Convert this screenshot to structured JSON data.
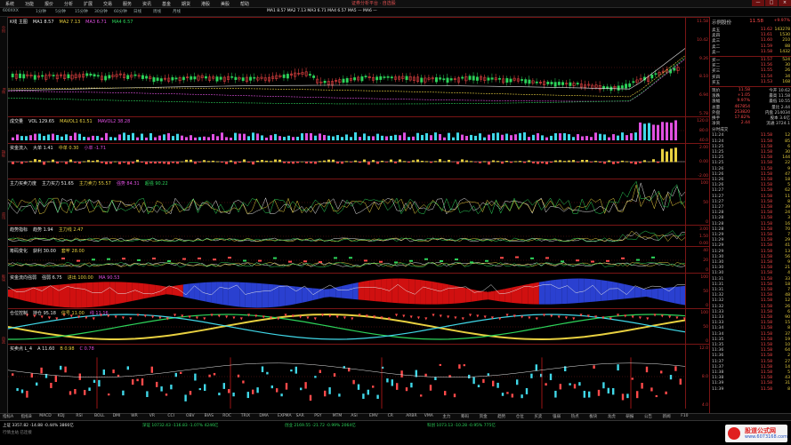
{
  "window": {
    "title": "证券分析平台 · 自选股",
    "controls": [
      "—",
      "□",
      "×"
    ]
  },
  "menu": [
    "系统",
    "功能",
    "报价",
    "分析",
    "扩展",
    "交易",
    "服务",
    "资讯",
    "基金",
    "期货",
    "港股",
    "美股",
    "帮助"
  ],
  "toolbar": {
    "stock_code": "600XXX",
    "periods": [
      "1分钟",
      "5分钟",
      "15分钟",
      "30分钟",
      "60分钟",
      "日线",
      "周线",
      "月线"
    ],
    "ma_label": "MA1 8.57  MA2 7.13  MA3 6.71  MA4 6.57  MA5 —  MA6 —"
  },
  "left_tabs": [
    "分时",
    "K线",
    "指标",
    "资讯",
    "板块",
    "自选"
  ],
  "panels": [
    {
      "name": "main-kline",
      "title": "K线 主图",
      "legends": [
        "MA1 8.57",
        "MA2 7.13",
        "MA3 6.71",
        "MA4 6.57"
      ],
      "ticks": [
        "11.58",
        "10.42",
        "9.26",
        "8.10",
        "6.94",
        "5.78"
      ]
    },
    {
      "name": "volume",
      "title": "成交量",
      "legends": [
        "VOL 129.65",
        "MAVOL1 61.51",
        "MAVOL2 38.28"
      ],
      "ticks": [
        "120.0",
        "80.0",
        "40.0"
      ]
    },
    {
      "name": "fund-flow",
      "title": "资金流入",
      "legends": [
        "大单 1.41",
        "中单 0.30",
        "小单 -1.71"
      ],
      "ticks": [
        "2.00",
        "0.00",
        "-2.00"
      ]
    },
    {
      "name": "main-force-line",
      "title": "主力买卖力度",
      "legends": [
        "主力买力 51.65",
        "主力卖力 55.57",
        "强势 84.31",
        "超强 90.22"
      ],
      "ticks": [
        "100",
        "50",
        "0"
      ]
    },
    {
      "name": "trend-indicator",
      "title": "趋势指标",
      "legends": [
        "趋势 1.94",
        "主力线 2.47"
      ],
      "ticks": [
        "3.00",
        "1.50",
        "0.00"
      ]
    },
    {
      "name": "chip-change",
      "title": "筹码变化",
      "legends": [
        "获利 30.00",
        "套牢 28.00"
      ],
      "ticks": [
        "40",
        "20",
        "0"
      ]
    },
    {
      "name": "capital-flow",
      "title": "资金流向强弱",
      "legends": [
        "强弱 6.75",
        "进出 100.00",
        "MA 90.53"
      ],
      "ticks": [
        "100",
        "50",
        "0"
      ]
    },
    {
      "name": "position-control",
      "title": "仓位控制",
      "legends": [
        "持仓 95.18",
        "信号 11.00",
        "线 11.16"
      ],
      "ticks": [
        "100",
        "50",
        "0"
      ]
    },
    {
      "name": "buy-sell-points",
      "title": "买卖点 L_4",
      "legends": [
        "A 11.60",
        "B 0.98",
        "C 0.78"
      ],
      "ticks": [
        "12.0",
        "8.0",
        "4.0"
      ]
    }
  ],
  "quote": {
    "name": "示例股份",
    "price": "11.58",
    "change": "+1.05",
    "pct": "+9.97%",
    "asks": [
      {
        "label": "卖五",
        "price": "11.62",
        "qty": "143278"
      },
      {
        "label": "卖四",
        "price": "11.61",
        "qty": "1530"
      },
      {
        "label": "卖三",
        "price": "11.60",
        "qty": "210"
      },
      {
        "label": "卖二",
        "price": "11.59",
        "qty": "88"
      },
      {
        "label": "卖一",
        "price": "11.58",
        "qty": "1432"
      }
    ],
    "bids": [
      {
        "label": "买一",
        "price": "11.57",
        "qty": "524"
      },
      {
        "label": "买二",
        "price": "11.56",
        "qty": "30"
      },
      {
        "label": "买三",
        "price": "11.55",
        "qty": "26"
      },
      {
        "label": "买四",
        "price": "11.54",
        "qty": "34"
      },
      {
        "label": "买五",
        "price": "11.53",
        "qty": "168"
      }
    ],
    "stats": [
      {
        "label": "现价",
        "value": "11.58",
        "extra": "今开 10.62"
      },
      {
        "label": "涨跌",
        "value": "+1.05",
        "extra": "最高 11.58"
      },
      {
        "label": "涨幅",
        "value": "9.97%",
        "extra": "最低 10.55"
      },
      {
        "label": "总量",
        "value": "467854",
        "extra": "量比 2.44"
      },
      {
        "label": "外盘",
        "value": "253820",
        "extra": "内盘 214034"
      },
      {
        "label": "换手",
        "value": "17.82%",
        "extra": "股本 3.6亿"
      },
      {
        "label": "净资",
        "value": "2.44",
        "extra": "流通 3724.1"
      }
    ],
    "ticks_header": "分时成交",
    "trades": [
      {
        "time": "11:24",
        "price": "11.58",
        "vol": "12"
      },
      {
        "time": "11:24",
        "price": "11.58",
        "vol": "85"
      },
      {
        "time": "11:25",
        "price": "11.58",
        "vol": "6"
      },
      {
        "time": "11:25",
        "price": "11.58",
        "vol": "30"
      },
      {
        "time": "11:25",
        "price": "11.58",
        "vol": "144"
      },
      {
        "time": "11:25",
        "price": "11.58",
        "vol": "22"
      },
      {
        "time": "11:26",
        "price": "11.58",
        "vol": "9"
      },
      {
        "time": "11:26",
        "price": "11.58",
        "vol": "47"
      },
      {
        "time": "11:26",
        "price": "11.58",
        "vol": "18"
      },
      {
        "time": "11:26",
        "price": "11.58",
        "vol": "5"
      },
      {
        "time": "11:27",
        "price": "11.58",
        "vol": "62"
      },
      {
        "time": "11:27",
        "price": "11.58",
        "vol": "11"
      },
      {
        "time": "11:27",
        "price": "11.58",
        "vol": "8"
      },
      {
        "time": "11:27",
        "price": "11.58",
        "vol": "39"
      },
      {
        "time": "11:28",
        "price": "11.58",
        "vol": "24"
      },
      {
        "time": "11:28",
        "price": "11.58",
        "vol": "3"
      },
      {
        "time": "11:28",
        "price": "11.58",
        "vol": "16"
      },
      {
        "time": "11:28",
        "price": "11.58",
        "vol": "70"
      },
      {
        "time": "11:29",
        "price": "11.58",
        "vol": "7"
      },
      {
        "time": "11:29",
        "price": "11.58",
        "vol": "29"
      },
      {
        "time": "11:29",
        "price": "11.58",
        "vol": "41"
      },
      {
        "time": "11:29",
        "price": "11.58",
        "vol": "13"
      },
      {
        "time": "11:30",
        "price": "11.58",
        "vol": "56"
      },
      {
        "time": "11:30",
        "price": "11.58",
        "vol": "9"
      },
      {
        "time": "11:30",
        "price": "11.58",
        "vol": "21"
      },
      {
        "time": "11:30",
        "price": "11.58",
        "vol": "4"
      },
      {
        "time": "11:31",
        "price": "11.58",
        "vol": "33"
      },
      {
        "time": "11:31",
        "price": "11.58",
        "vol": "18"
      },
      {
        "time": "11:31",
        "price": "11.58",
        "vol": "7"
      },
      {
        "time": "11:32",
        "price": "11.58",
        "vol": "48"
      },
      {
        "time": "11:32",
        "price": "11.58",
        "vol": "12"
      },
      {
        "time": "11:32",
        "price": "11.58",
        "vol": "26"
      },
      {
        "time": "11:33",
        "price": "11.58",
        "vol": "6"
      },
      {
        "time": "11:33",
        "price": "11.58",
        "vol": "90"
      },
      {
        "time": "11:33",
        "price": "11.58",
        "vol": "15"
      },
      {
        "time": "11:34",
        "price": "11.58",
        "vol": "8"
      },
      {
        "time": "11:34",
        "price": "11.58",
        "vol": "37"
      },
      {
        "time": "11:35",
        "price": "11.58",
        "vol": "19"
      },
      {
        "time": "11:35",
        "price": "11.58",
        "vol": "10"
      },
      {
        "time": "11:36",
        "price": "11.58",
        "vol": "64"
      },
      {
        "time": "11:36",
        "price": "11.58",
        "vol": "2"
      },
      {
        "time": "11:37",
        "price": "11.58",
        "vol": "27"
      },
      {
        "time": "11:37",
        "price": "11.58",
        "vol": "14"
      },
      {
        "time": "11:38",
        "price": "11.58",
        "vol": "5"
      },
      {
        "time": "11:38",
        "price": "11.58",
        "vol": "43"
      },
      {
        "time": "11:39",
        "price": "11.58",
        "vol": "31"
      },
      {
        "time": "11:39",
        "price": "11.58",
        "vol": "8"
      }
    ]
  },
  "bottom_tabs": [
    "指标A",
    "指标B",
    "MACD",
    "KDJ",
    "RSI",
    "BOLL",
    "DMI",
    "WR",
    "VR",
    "CCI",
    "OBV",
    "BIAS",
    "ROC",
    "TRIX",
    "DMA",
    "EXPMA",
    "SAR",
    "PSY",
    "MTM",
    "ASI",
    "EMV",
    "CR",
    "ARBR",
    "VMA",
    "主力",
    "筹码",
    "资金",
    "趋势",
    "仓位",
    "买卖",
    "强弱",
    "热点",
    "板块",
    "龙虎",
    "研报",
    "公告",
    "新闻",
    "F10"
  ],
  "status": {
    "index1": "上证 3357.82  -14.88  -0.44%  3866亿",
    "index2": "深证 10732.43  -116.83  -1.07%  4246亿",
    "index3": "创业 2169.55  -21.72  -0.99%  2064亿",
    "index4": "科创 1073.13  -10.28  -0.95%  775亿",
    "connection": "行情主站 已连接"
  },
  "logo": {
    "line1": "股道公式网",
    "line2": "www.6073168.com"
  },
  "colors": {
    "up": "#ff4a4a",
    "down": "#2dd45a",
    "grid": "#7a1515",
    "accent": "#e8d040"
  }
}
